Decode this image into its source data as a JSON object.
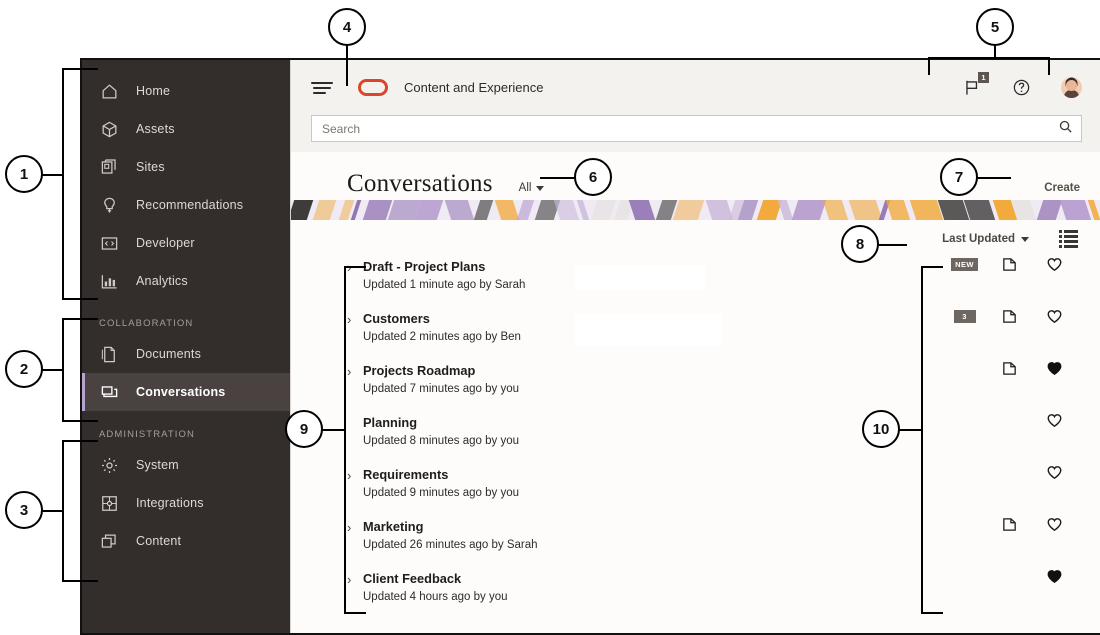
{
  "app": {
    "brand_title": "Content and Experience",
    "brand_mark": "oracle-oval-logo",
    "menu_icon": "hamburger-menu-icon"
  },
  "search": {
    "placeholder": "Search",
    "value": "",
    "icon": "search-icon"
  },
  "topbar_right": {
    "notifications": {
      "icon": "flag-icon",
      "badge": "1"
    },
    "help": {
      "icon": "help-question-icon"
    },
    "profile": {
      "icon": "user-avatar"
    }
  },
  "sidebar": {
    "groups": [
      {
        "label": "",
        "items": [
          {
            "label": "Home",
            "icon": "home-icon",
            "active": false
          },
          {
            "label": "Assets",
            "icon": "cube-icon",
            "active": false
          },
          {
            "label": "Sites",
            "icon": "sites-pages-icon",
            "active": false
          },
          {
            "label": "Recommendations",
            "icon": "lightbulb-icon",
            "active": false
          },
          {
            "label": "Developer",
            "icon": "code-brackets-icon",
            "active": false
          },
          {
            "label": "Analytics",
            "icon": "bar-chart-icon",
            "active": false
          }
        ]
      },
      {
        "label": "COLLABORATION",
        "items": [
          {
            "label": "Documents",
            "icon": "documents-icon",
            "active": false
          },
          {
            "label": "Conversations",
            "icon": "conversations-speech-icon",
            "active": true
          }
        ]
      },
      {
        "label": "ADMINISTRATION",
        "items": [
          {
            "label": "System",
            "icon": "gear-icon",
            "active": false
          },
          {
            "label": "Integrations",
            "icon": "integrations-puzzle-icon",
            "active": false
          },
          {
            "label": "Content",
            "icon": "content-layers-icon",
            "active": false
          }
        ]
      }
    ]
  },
  "page": {
    "title": "Conversations",
    "filter": {
      "label": "All",
      "icon": "chevron-down-icon"
    },
    "create_label": "Create",
    "sort": {
      "label": "Last Updated",
      "icon": "chevron-down-icon"
    },
    "view_toggle_icon": "list-view-icon"
  },
  "conversations": [
    {
      "title": "Draft - Project Plans",
      "subtitle": "Updated 1 minute ago by Sarah",
      "has_chevron": true,
      "badge": "NEW",
      "folder": true,
      "favorite": false,
      "redacted": true
    },
    {
      "title": "Customers",
      "subtitle": "Updated 2 minutes ago by Ben",
      "has_chevron": true,
      "badge": "3",
      "folder": true,
      "favorite": false,
      "redacted": true
    },
    {
      "title": "Projects Roadmap",
      "subtitle": "Updated 7 minutes ago by you",
      "has_chevron": true,
      "badge": "",
      "folder": true,
      "favorite": true,
      "redacted": false
    },
    {
      "title": "Planning",
      "subtitle": "Updated 8 minutes ago by you",
      "has_chevron": false,
      "badge": "",
      "folder": false,
      "favorite": false,
      "redacted": false
    },
    {
      "title": "Requirements",
      "subtitle": "Updated 9 minutes ago by you",
      "has_chevron": true,
      "badge": "",
      "folder": false,
      "favorite": false,
      "redacted": false
    },
    {
      "title": "Marketing",
      "subtitle": "Updated 26 minutes ago by Sarah",
      "has_chevron": true,
      "badge": "",
      "folder": true,
      "favorite": false,
      "redacted": false
    },
    {
      "title": "Client Feedback",
      "subtitle": "Updated 4 hours ago by you",
      "has_chevron": true,
      "badge": "",
      "folder": false,
      "favorite": true,
      "redacted": false
    }
  ],
  "callouts": [
    {
      "number": "1"
    },
    {
      "number": "2"
    },
    {
      "number": "3"
    },
    {
      "number": "4"
    },
    {
      "number": "5"
    },
    {
      "number": "6"
    },
    {
      "number": "7"
    },
    {
      "number": "8"
    },
    {
      "number": "9"
    },
    {
      "number": "10"
    }
  ],
  "colors": {
    "sidebar_bg": "#332d2b",
    "sidebar_active_bg": "#4a4240",
    "accent_marker": "#b9a4cf",
    "brand_red": "#d9462b",
    "page_bg": "#fdfcfa",
    "topbar_bg": "#f4f2ef",
    "badge_bg": "#6d6661",
    "banner_purple": "#8e6fb0",
    "banner_orange": "#f2a93b",
    "banner_dark": "#3c3a38"
  }
}
